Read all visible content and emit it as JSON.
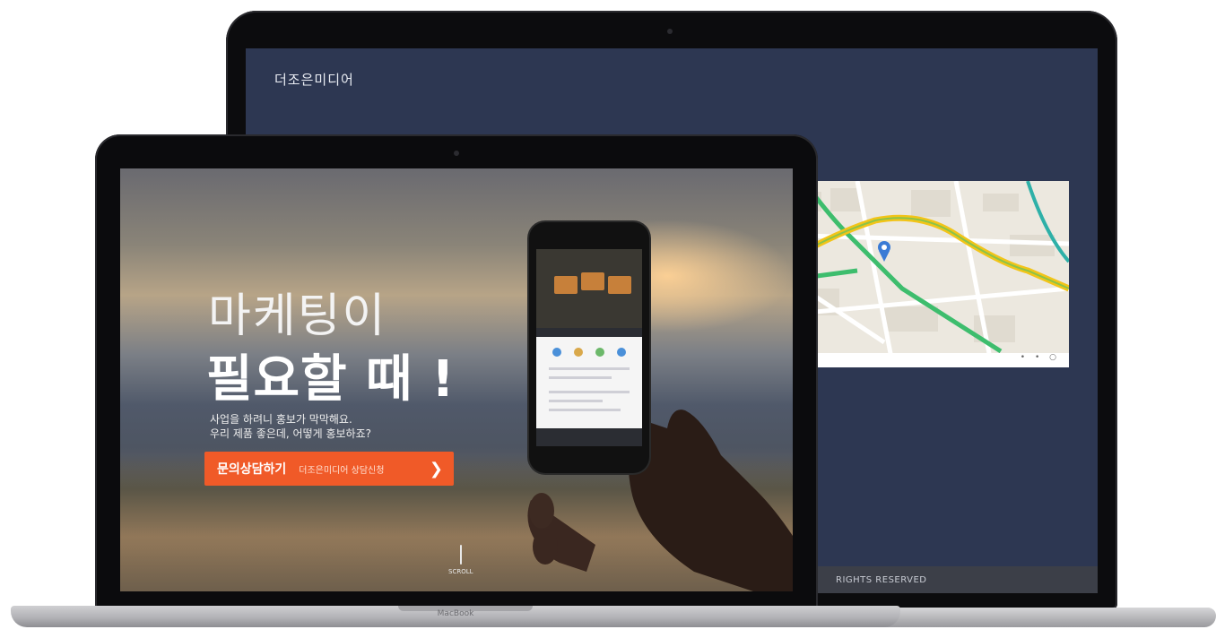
{
  "back_laptop": {
    "logo": "더조은미디어",
    "footer": "RIGHTS RESERVED",
    "map_controls": "• • ○"
  },
  "front_laptop": {
    "headline_line1": "마케팅이",
    "headline_line2": "필요할 때 !",
    "sub_line1": "사업을 하려니 홍보가 막막해요.",
    "sub_line2": "우리 제품 좋은데, 어떻게 홍보하죠?",
    "cta_main": "문의상담하기",
    "cta_sub": "더조은미디어 상담신청",
    "cta_arrow": "❯",
    "scroll_label": "SCROLL",
    "macbook_label": "MacBook"
  },
  "colors": {
    "back_screen": "#2d3752",
    "cta_orange": "#f05a28"
  }
}
